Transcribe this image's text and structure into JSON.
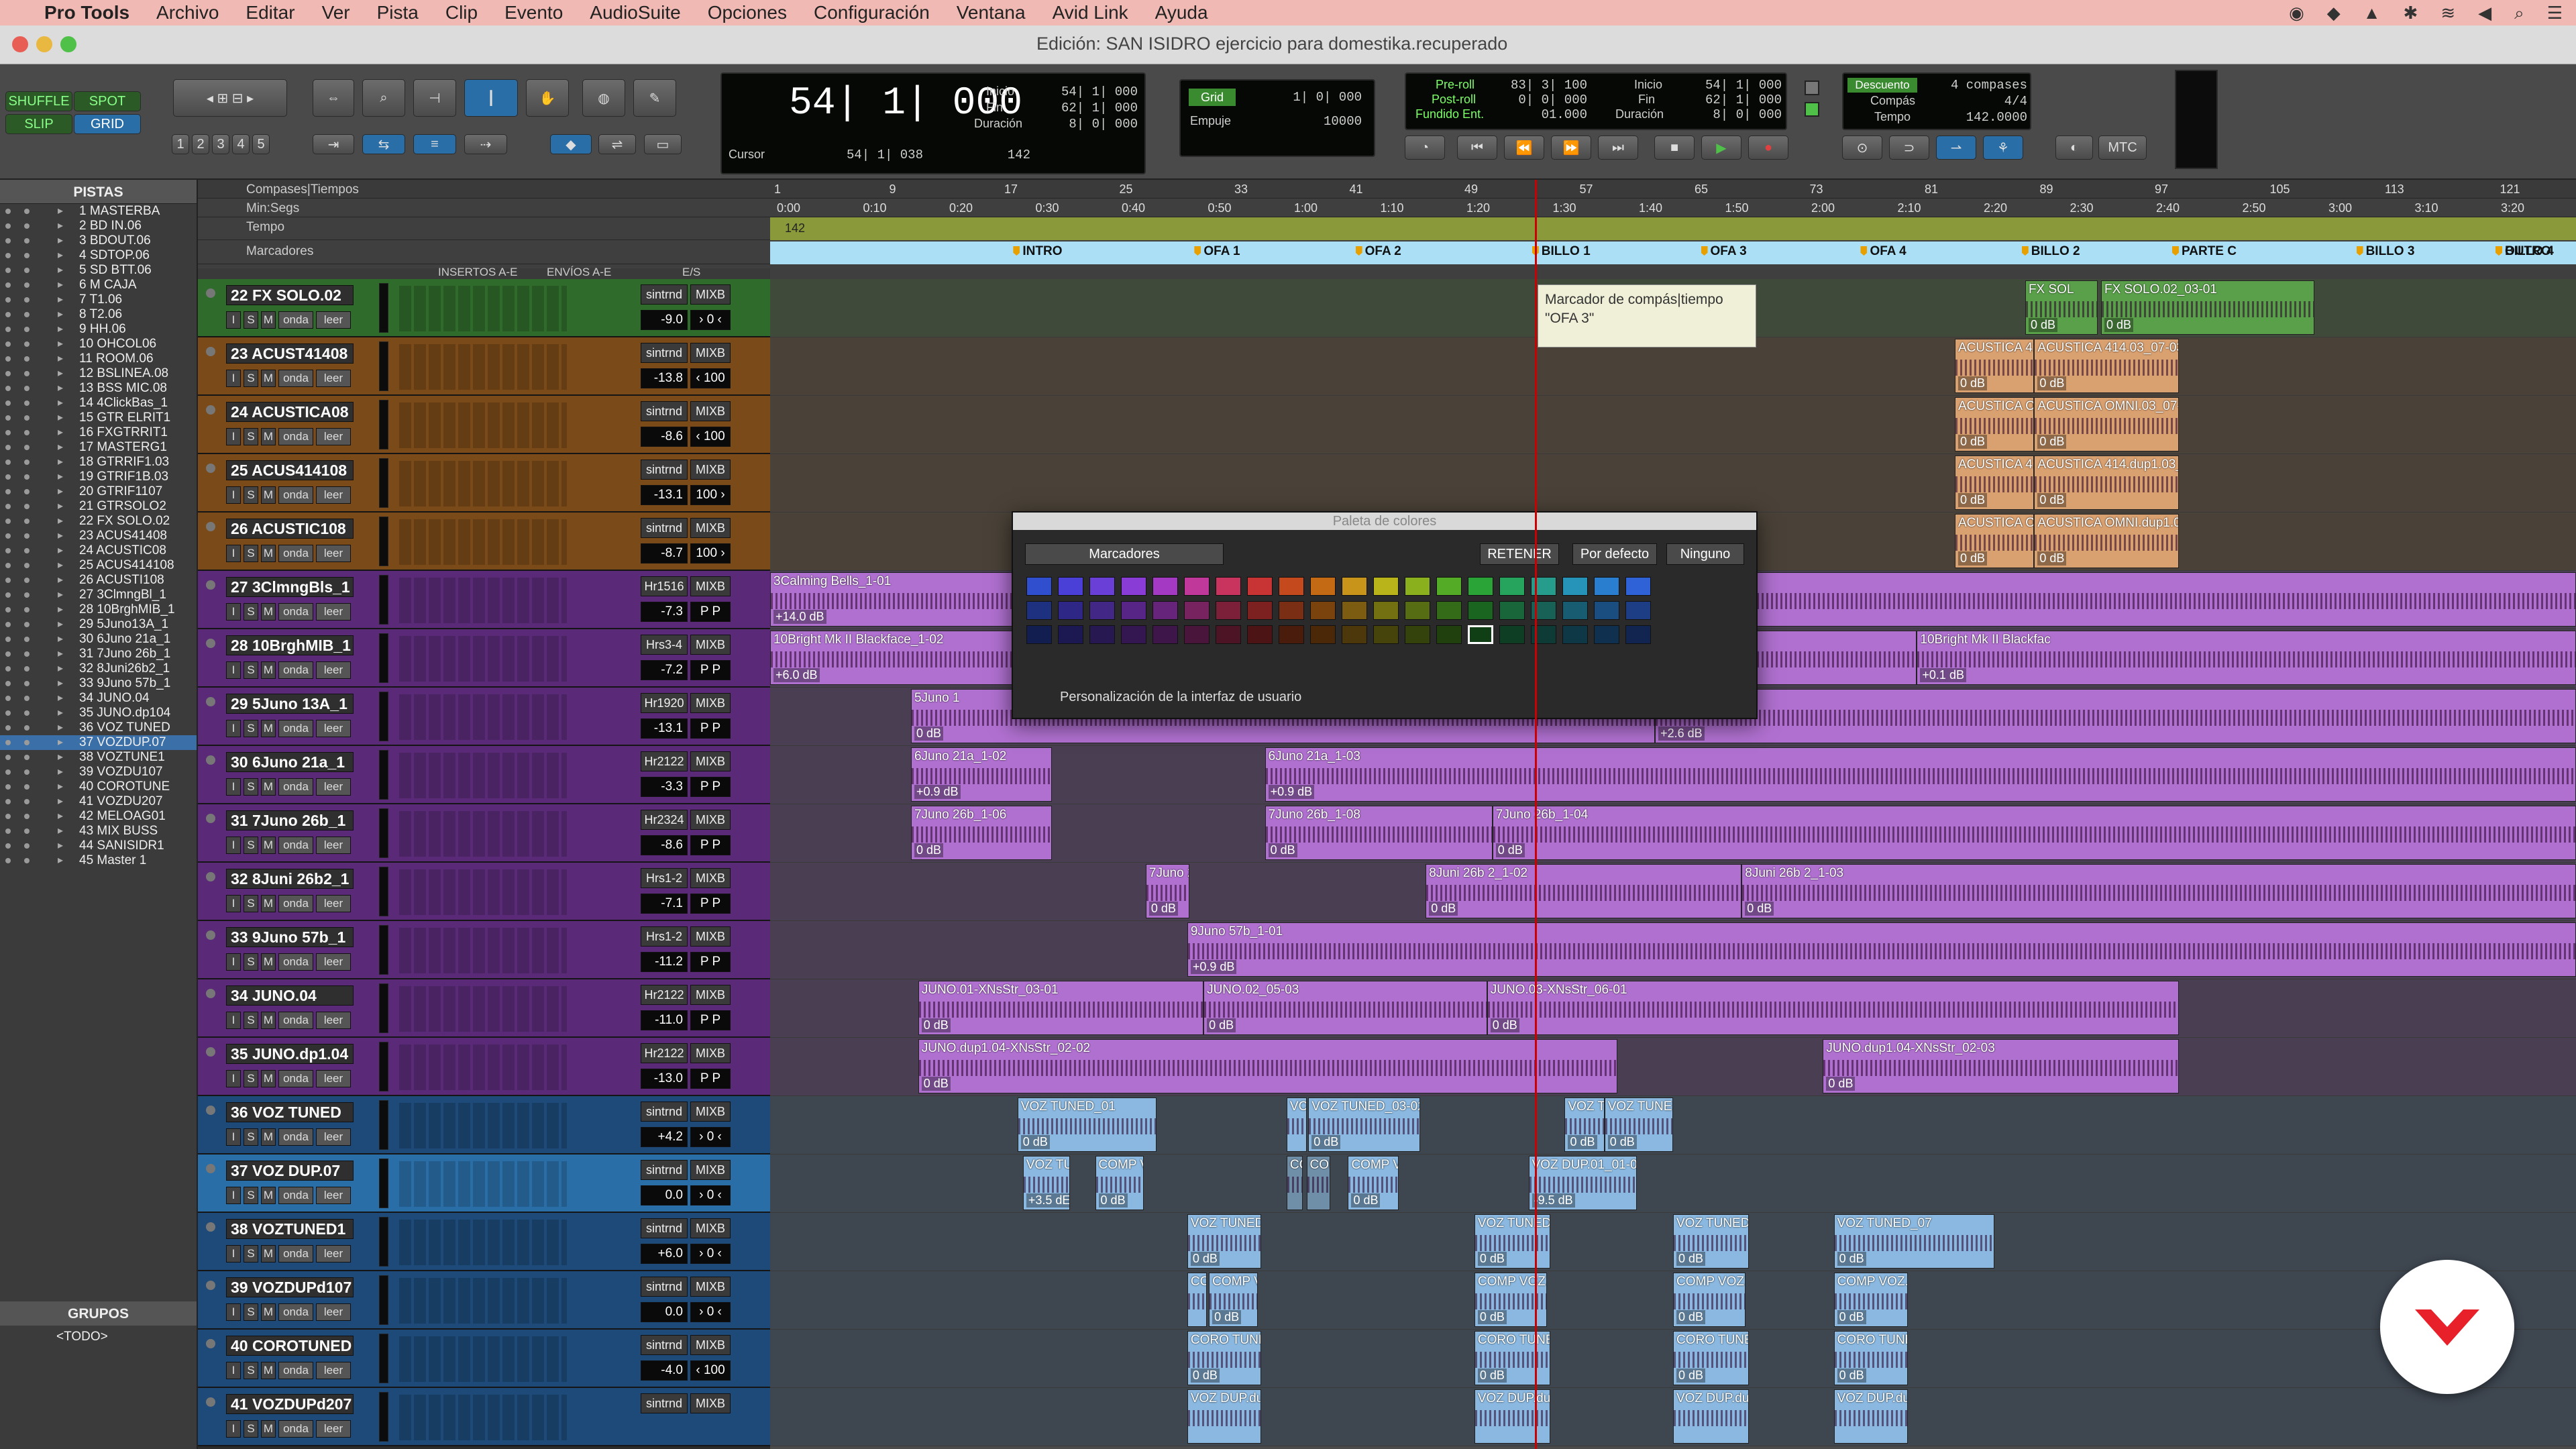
{
  "menubar": {
    "app": "Pro Tools",
    "items": [
      "Archivo",
      "Editar",
      "Ver",
      "Pista",
      "Clip",
      "Evento",
      "AudioSuite",
      "Opciones",
      "Configuración",
      "Ventana",
      "Avid Link",
      "Ayuda"
    ]
  },
  "window": {
    "title": "Edición: SAN ISIDRO ejercicio para domestika.recuperado"
  },
  "toolbar": {
    "modes": [
      "SHUFFLE",
      "SPOT",
      "SLIP",
      "GRID"
    ],
    "counter_main": "54| 1| 000",
    "counter_labels": [
      "Inicio",
      "Fin",
      "Duración"
    ],
    "counter_values": [
      "54| 1| 000",
      "62| 1| 000",
      "8| 0| 000"
    ],
    "cursor_label": "Cursor",
    "cursor_value": "54| 1| 038",
    "cursor_num": "142",
    "grid_label": "Grid",
    "grid_value": "1| 0| 000",
    "nudge_label": "Empuje",
    "nudge_value": "10000",
    "preroll_labels": [
      "Pre-roll",
      "Post-roll",
      "Fundido Ent."
    ],
    "preroll_values": [
      "83| 3| 100",
      "0| 0| 000",
      "01.000"
    ],
    "sel_labels": [
      "Inicio",
      "Fin",
      "Duración"
    ],
    "sel_values": [
      "54| 1| 000",
      "62| 1| 000",
      "8| 0| 000"
    ],
    "countoff": "Descuento",
    "countoff_val": "4 compases",
    "meter_label": "Compás",
    "meter_val": "4/4",
    "tempo_label": "Tempo",
    "tempo_val": "142.0000",
    "mtc": "MTC",
    "numbers": [
      "1",
      "2",
      "3",
      "4",
      "5"
    ]
  },
  "tracklist": {
    "header": "PISTAS",
    "items": [
      "1 MASTERBA",
      "2 BD IN.06",
      "3 BDOUT.06",
      "4 SDTOP.06",
      "5 SD BTT.06",
      "6 M CAJA",
      "7 T1.06",
      "8 T2.06",
      "9 HH.06",
      "10 OHCOL06",
      "11 ROOM.06",
      "12 BSLINEA.08",
      "13 BSS MIC.08",
      "14 4ClickBas_1",
      "15 GTR ELRIT1",
      "16 FXGTRRIT1",
      "17 MASTERG1",
      "18 GTRRIF1.03",
      "19 GTRIF1B.03",
      "20 GTRIF1107",
      "21 GTRSOLO2",
      "22 FX SOLO.02",
      "23 ACUS41408",
      "24 ACUSTIC08",
      "25 ACUS414108",
      "26 ACUSTI108",
      "27 3ClmngBl_1",
      "28 10BrghMIB_1",
      "29 5Juno13A_1",
      "30 6Juno 21a_1",
      "31 7Juno 26b_1",
      "32 8Juni26b2_1",
      "33 9Juno 57b_1",
      "34 JUNO.04",
      "35 JUNO.dp104",
      "36 VOZ TUNED",
      "37 VOZDUP.07",
      "38 VOZTUNE1",
      "39 VOZDU107",
      "40 COROTUNE",
      "41 VOZDU207",
      "42 MELOAG01",
      "43 MIX BUSS",
      "44 SANISIDR1",
      "45 Master 1"
    ],
    "selected_index": 36
  },
  "groups": {
    "header": "GRUPOS",
    "all": "<TODO>"
  },
  "rulers": {
    "rows": [
      "Compases|Tiempos",
      "Min:Segs",
      "Tempo",
      "Marcadores"
    ],
    "bars": [
      "1",
      "9",
      "17",
      "25",
      "33",
      "41",
      "49",
      "57",
      "65",
      "73",
      "81",
      "89",
      "97",
      "105",
      "113",
      "121"
    ],
    "minsecs": [
      "0:00",
      "0:10",
      "0:20",
      "0:30",
      "0:40",
      "0:50",
      "1:00",
      "1:10",
      "1:20",
      "1:30",
      "1:40",
      "1:50",
      "2:00",
      "2:10",
      "2:20",
      "2:30",
      "2:40",
      "2:50",
      "3:00",
      "3:10",
      "3:20"
    ],
    "tempo_value": "142",
    "markers": [
      "INTRO",
      "OFA 1",
      "OFA 2",
      "BILLO 1",
      "OFA 3",
      "OFA 4",
      "BILLO 2",
      "PARTE C",
      "BILLO 3",
      "BILLO 4",
      "OUTRO"
    ]
  },
  "trackheader_cols": [
    "INSERTOS A-E",
    "ENVÍOS A-E",
    "E/S"
  ],
  "tracks": [
    {
      "name": "22  FX SOLO.02",
      "io1": "sintrnd",
      "io2": "MIXB",
      "vol": "-9.0",
      "pan": "› 0 ‹",
      "color": "#2f6b2a",
      "lane": "#3f4a3a"
    },
    {
      "name": "23  ACUST41408",
      "io1": "sintrnd",
      "io2": "MIXB",
      "vol": "-13.8",
      "pan": "‹ 100",
      "color": "#7a4a18",
      "lane": "#4a4238"
    },
    {
      "name": "24  ACUSTICA08",
      "io1": "sintrnd",
      "io2": "MIXB",
      "vol": "-8.6",
      "pan": "‹ 100",
      "color": "#7a4a18",
      "lane": "#4a4238"
    },
    {
      "name": "25  ACUS414108",
      "io1": "sintrnd",
      "io2": "MIXB",
      "vol": "-13.1",
      "pan": "100 ›",
      "color": "#7a4a18",
      "lane": "#4a4238"
    },
    {
      "name": "26  ACUSTIC108",
      "io1": "sintrnd",
      "io2": "MIXB",
      "vol": "-8.7",
      "pan": "100 ›",
      "color": "#7a4a18",
      "lane": "#4a4238"
    },
    {
      "name": "27  3ClmngBls_1",
      "io1": "Hr1516",
      "io2": "MIXB",
      "vol": "-7.3",
      "pan": "P   P",
      "color": "#5a2a78",
      "lane": "#4a3e52"
    },
    {
      "name": "28  10BrghMIB_1",
      "io1": "Hrs3-4",
      "io2": "MIXB",
      "vol": "-7.2",
      "pan": "P   P",
      "color": "#5a2a78",
      "lane": "#4a3e52"
    },
    {
      "name": "29  5Juno 13A_1",
      "io1": "Hr1920",
      "io2": "MIXB",
      "vol": "-13.1",
      "pan": "P   P",
      "color": "#5a2a78",
      "lane": "#4a3e52"
    },
    {
      "name": "30  6Juno 21a_1",
      "io1": "Hr2122",
      "io2": "MIXB",
      "vol": "-3.3",
      "pan": "P   P",
      "color": "#5a2a78",
      "lane": "#4a3e52"
    },
    {
      "name": "31  7Juno 26b_1",
      "io1": "Hr2324",
      "io2": "MIXB",
      "vol": "-8.6",
      "pan": "P   P",
      "color": "#5a2a78",
      "lane": "#4a3e52"
    },
    {
      "name": "32  8Juni 26b2_1",
      "io1": "Hrs1-2",
      "io2": "MIXB",
      "vol": "-7.1",
      "pan": "P   P",
      "color": "#5a2a78",
      "lane": "#4a3e52"
    },
    {
      "name": "33  9Juno 57b_1",
      "io1": "Hrs1-2",
      "io2": "MIXB",
      "vol": "-11.2",
      "pan": "P   P",
      "color": "#5a2a78",
      "lane": "#4a3e52"
    },
    {
      "name": "34     JUNO.04",
      "io1": "Hr2122",
      "io2": "MIXB",
      "vol": "-11.0",
      "pan": "P   P",
      "color": "#5a2a78",
      "lane": "#4a3e52"
    },
    {
      "name": "35  JUNO.dp1.04",
      "io1": "Hr2122",
      "io2": "MIXB",
      "vol": "-13.0",
      "pan": "P   P",
      "color": "#5a2a78",
      "lane": "#4a3e52"
    },
    {
      "name": "36  VOZ TUNED",
      "io1": "sintrnd",
      "io2": "MIXB",
      "vol": "+4.2",
      "pan": "› 0 ‹",
      "color": "#1d4a78",
      "lane": "#3e4650"
    },
    {
      "name": "37  VOZ DUP.07",
      "io1": "sintrnd",
      "io2": "MIXB",
      "vol": "0.0",
      "pan": "› 0 ‹",
      "color": "#2a6ea8",
      "lane": "#3e4650",
      "selected": true
    },
    {
      "name": "38  VOZTUNED1",
      "io1": "sintrnd",
      "io2": "MIXB",
      "vol": "+6.0",
      "pan": "› 0 ‹",
      "color": "#1d4a78",
      "lane": "#3e4650"
    },
    {
      "name": "39  VOZDUPd107",
      "io1": "sintrnd",
      "io2": "MIXB",
      "vol": "0.0",
      "pan": "› 0 ‹",
      "color": "#1d4a78",
      "lane": "#3e4650"
    },
    {
      "name": "40  COROTUNED",
      "io1": "sintrnd",
      "io2": "MIXB",
      "vol": "-4.0",
      "pan": "‹ 100",
      "color": "#1d4a78",
      "lane": "#3e4650"
    },
    {
      "name": "41  VOZDUPd207",
      "io1": "sintrnd",
      "io2": "MIXB",
      "vol": "",
      "pan": "",
      "color": "#1d4a78",
      "lane": "#3e4650"
    }
  ],
  "track_buttons": [
    "I",
    "S",
    "M",
    "onda",
    "leer"
  ],
  "clips": [
    {
      "t": 0,
      "name": "FX SOL",
      "gain": "0 dB",
      "color": "#5aa04a",
      "start": 0.695,
      "end": 0.735
    },
    {
      "t": 0,
      "name": "FX SOLO.02_03-01",
      "gain": "0 dB",
      "color": "#5aa04a",
      "start": 0.737,
      "end": 0.855
    },
    {
      "t": 1,
      "name": "ACUSTICA 414.0",
      "gain": "0 dB",
      "color": "#d9a070",
      "start": 0.656,
      "end": 0.7
    },
    {
      "t": 1,
      "name": "ACUSTICA 414.03_07-03",
      "gain": "0 dB",
      "color": "#d9a070",
      "start": 0.7,
      "end": 0.78
    },
    {
      "t": 2,
      "name": "ACUSTICA OMN",
      "gain": "0 dB",
      "color": "#d9a070",
      "start": 0.656,
      "end": 0.7
    },
    {
      "t": 2,
      "name": "ACUSTICA OMNI.03_07-03",
      "gain": "0 dB",
      "color": "#d9a070",
      "start": 0.7,
      "end": 0.78
    },
    {
      "t": 3,
      "name": "ACUSTICA 414.d",
      "gain": "0 dB",
      "color": "#d9a070",
      "start": 0.656,
      "end": 0.7
    },
    {
      "t": 3,
      "name": "ACUSTICA 414.dup1.03_01-03",
      "gain": "0 dB",
      "color": "#d9a070",
      "start": 0.7,
      "end": 0.78
    },
    {
      "t": 4,
      "name": "ACUSTICA OMN",
      "gain": "0 dB",
      "color": "#d9a070",
      "start": 0.656,
      "end": 0.7
    },
    {
      "t": 4,
      "name": "ACUSTICA OMNI.dup1.03_01-03",
      "gain": "0 dB",
      "color": "#d9a070",
      "start": 0.7,
      "end": 0.78
    },
    {
      "t": 5,
      "name": "3Calming Bells_1-01",
      "gain": "+14.0 dB",
      "color": "#b070d0",
      "start": 0.0,
      "end": 1.0
    },
    {
      "t": 6,
      "name": "10Bright Mk II Blackface_1-02",
      "gain": "+6.0 dB",
      "color": "#b070d0",
      "start": 0.0,
      "end": 0.635
    },
    {
      "t": 6,
      "name": "10Bright Mk II Blackfac",
      "gain": "+0.1 dB",
      "color": "#b070d0",
      "start": 0.635,
      "end": 1.0
    },
    {
      "t": 7,
      "name": "5Juno 1",
      "gain": "0 dB",
      "color": "#b070d0",
      "start": 0.078,
      "end": 0.49
    },
    {
      "t": 7,
      "name": "5Juno 13A_1-05",
      "gain": "+2.6 dB",
      "color": "#b070d0",
      "start": 0.49,
      "end": 1.0
    },
    {
      "t": 8,
      "name": "6Juno 21a_1-02",
      "gain": "+0.9 dB",
      "color": "#b070d0",
      "start": 0.078,
      "end": 0.156
    },
    {
      "t": 8,
      "name": "6Juno 21a_1-03",
      "gain": "+0.9 dB",
      "color": "#b070d0",
      "start": 0.274,
      "end": 1.0
    },
    {
      "t": 9,
      "name": "7Juno 26b_1-06",
      "gain": "0 dB",
      "color": "#b070d0",
      "start": 0.078,
      "end": 0.156
    },
    {
      "t": 9,
      "name": "7Juno 26b_1-08",
      "gain": "0 dB",
      "color": "#b070d0",
      "start": 0.274,
      "end": 0.4
    },
    {
      "t": 9,
      "name": "7Juno 26b_1-04",
      "gain": "0 dB",
      "color": "#b070d0",
      "start": 0.4,
      "end": 1.0
    },
    {
      "t": 10,
      "name": "7Juno 2(",
      "gain": "0 dB",
      "color": "#b070d0",
      "start": 0.208,
      "end": 0.232
    },
    {
      "t": 10,
      "name": "8Juni 26b 2_1-02",
      "gain": "0 dB",
      "color": "#b070d0",
      "start": 0.363,
      "end": 0.538
    },
    {
      "t": 10,
      "name": "8Juni 26b 2_1-03",
      "gain": "0 dB",
      "color": "#b070d0",
      "start": 0.538,
      "end": 1.0
    },
    {
      "t": 11,
      "name": "9Juno 57b_1-01",
      "gain": "+0.9 dB",
      "color": "#b070d0",
      "start": 0.231,
      "end": 1.0
    },
    {
      "t": 12,
      "name": "JUNO.01-XNsStr_03-01",
      "gain": "0 dB",
      "color": "#b070d0",
      "start": 0.082,
      "end": 0.24
    },
    {
      "t": 12,
      "name": "JUNO.02_05-03",
      "gain": "0 dB",
      "color": "#b070d0",
      "start": 0.24,
      "end": 0.397
    },
    {
      "t": 12,
      "name": "JUNO.03-XNsStr_06-01",
      "gain": "0 dB",
      "color": "#b070d0",
      "start": 0.397,
      "end": 0.78
    },
    {
      "t": 13,
      "name": "JUNO.dup1.04-XNsStr_02-02",
      "gain": "0 dB",
      "color": "#b070d0",
      "start": 0.082,
      "end": 0.469
    },
    {
      "t": 13,
      "name": "JUNO.dup1.04-XNsStr_02-03",
      "gain": "0 dB",
      "color": "#b070d0",
      "start": 0.583,
      "end": 0.78
    },
    {
      "t": 14,
      "name": "VOZ TUNED_01",
      "gain": "0 dB",
      "color": "#8ab8e0",
      "start": 0.137,
      "end": 0.214
    },
    {
      "t": 14,
      "name": "VC",
      "gain": "",
      "color": "#8ab8e0",
      "start": 0.286,
      "end": 0.297
    },
    {
      "t": 14,
      "name": "VOZ TUNED_03-02",
      "gain": "0 dB",
      "color": "#8ab8e0",
      "start": 0.298,
      "end": 0.36
    },
    {
      "t": 14,
      "name": "VOZ TU",
      "gain": "0 dB",
      "color": "#8ab8e0",
      "start": 0.44,
      "end": 0.462
    },
    {
      "t": 14,
      "name": "VOZ TUNED",
      "gain": "0 dB",
      "color": "#8ab8e0",
      "start": 0.462,
      "end": 0.5
    },
    {
      "t": 15,
      "name": "VOZ TUN",
      "gain": "+3.5 dE",
      "color": "#8ab8e0",
      "start": 0.14,
      "end": 0.166
    },
    {
      "t": 15,
      "name": "COMP VC",
      "gain": "0 dB",
      "color": "#8ab8e0",
      "start": 0.18,
      "end": 0.207
    },
    {
      "t": 15,
      "name": "CC",
      "gain": "",
      "color": "#6f8ea8",
      "start": 0.286,
      "end": 0.295
    },
    {
      "t": 15,
      "name": "COM",
      "gain": "",
      "color": "#6f8ea8",
      "start": 0.297,
      "end": 0.31
    },
    {
      "t": 15,
      "name": "COMP VO.",
      "gain": "0 dB",
      "color": "#8ab8e0",
      "start": 0.32,
      "end": 0.348
    },
    {
      "t": 15,
      "name": "VOZ DUP.01_01-03",
      "gain": "-9.5 dB",
      "color": "#8ab8e0",
      "start": 0.42,
      "end": 0.48
    },
    {
      "t": 16,
      "name": "VOZ TUNED_0",
      "gain": "0 dB",
      "color": "#8ab8e0",
      "start": 0.231,
      "end": 0.272
    },
    {
      "t": 16,
      "name": "VOZ TUNED_04",
      "gain": "0 dB",
      "color": "#8ab8e0",
      "start": 0.39,
      "end": 0.432
    },
    {
      "t": 16,
      "name": "VOZ TUNED_06",
      "gain": "0 dB",
      "color": "#8ab8e0",
      "start": 0.5,
      "end": 0.542
    },
    {
      "t": 16,
      "name": "VOZ TUNED_07",
      "gain": "0 dB",
      "color": "#8ab8e0",
      "start": 0.589,
      "end": 0.678
    },
    {
      "t": 17,
      "name": "CC",
      "gain": "",
      "color": "#8ab8e0",
      "start": 0.231,
      "end": 0.242
    },
    {
      "t": 17,
      "name": "COMP VI",
      "gain": "0 dB",
      "color": "#8ab8e0",
      "start": 0.243,
      "end": 0.27
    },
    {
      "t": 17,
      "name": "COMP VOZ.du",
      "gain": "0 dB",
      "color": "#8ab8e0",
      "start": 0.39,
      "end": 0.43
    },
    {
      "t": 17,
      "name": "COMP VOZ.dup",
      "gain": "0 dB",
      "color": "#8ab8e0",
      "start": 0.5,
      "end": 0.54
    },
    {
      "t": 17,
      "name": "COMP VOZ.du",
      "gain": "0 dB",
      "color": "#8ab8e0",
      "start": 0.589,
      "end": 0.63
    },
    {
      "t": 18,
      "name": "CORO TUNED_",
      "gain": "0 dB",
      "color": "#8ab8e0",
      "start": 0.231,
      "end": 0.272
    },
    {
      "t": 18,
      "name": "CORO TUNED_",
      "gain": "0 dB",
      "color": "#8ab8e0",
      "start": 0.39,
      "end": 0.432
    },
    {
      "t": 18,
      "name": "CORO TUNED_",
      "gain": "0 dB",
      "color": "#8ab8e0",
      "start": 0.5,
      "end": 0.542
    },
    {
      "t": 18,
      "name": "CORO TUNED",
      "gain": "0 dB",
      "color": "#8ab8e0",
      "start": 0.589,
      "end": 0.63
    },
    {
      "t": 19,
      "name": "VOZ DUP.dup1.0",
      "gain": "",
      "color": "#8ab8e0",
      "start": 0.231,
      "end": 0.272
    },
    {
      "t": 19,
      "name": "VOZ DUP.dup1.",
      "gain": "",
      "color": "#8ab8e0",
      "start": 0.39,
      "end": 0.432
    },
    {
      "t": 19,
      "name": "VOZ DUP.dup1.",
      "gain": "",
      "color": "#8ab8e0",
      "start": 0.5,
      "end": 0.542
    },
    {
      "t": 19,
      "name": "VOZ DUP.dup1.",
      "gain": "",
      "color": "#8ab8e0",
      "start": 0.589,
      "end": 0.63
    }
  ],
  "palette": {
    "title": "Paleta de colores",
    "dropdown": "Marcadores",
    "buttons": [
      "RETENER",
      "Por defecto",
      "Ninguno"
    ],
    "footer": "Personalización de la interfaz de usuario",
    "selected_row": 2,
    "selected_col": 14,
    "colors": [
      "#2f4fcf",
      "#4a3fd6",
      "#6a3fd8",
      "#8a3cd6",
      "#a43ac4",
      "#c0389a",
      "#c8345e",
      "#c83434",
      "#c44a1e",
      "#c46a14",
      "#c8941a",
      "#b8b41a",
      "#8ab01e",
      "#54ac26",
      "#2aa436",
      "#26a45e",
      "#269c8c",
      "#2694b8",
      "#2a7ed0",
      "#2f62d6",
      "#2f4fcf"
    ]
  },
  "tooltip": {
    "line1": "Marcador de compás|tiempo",
    "line2": "\"OFA 3\""
  }
}
